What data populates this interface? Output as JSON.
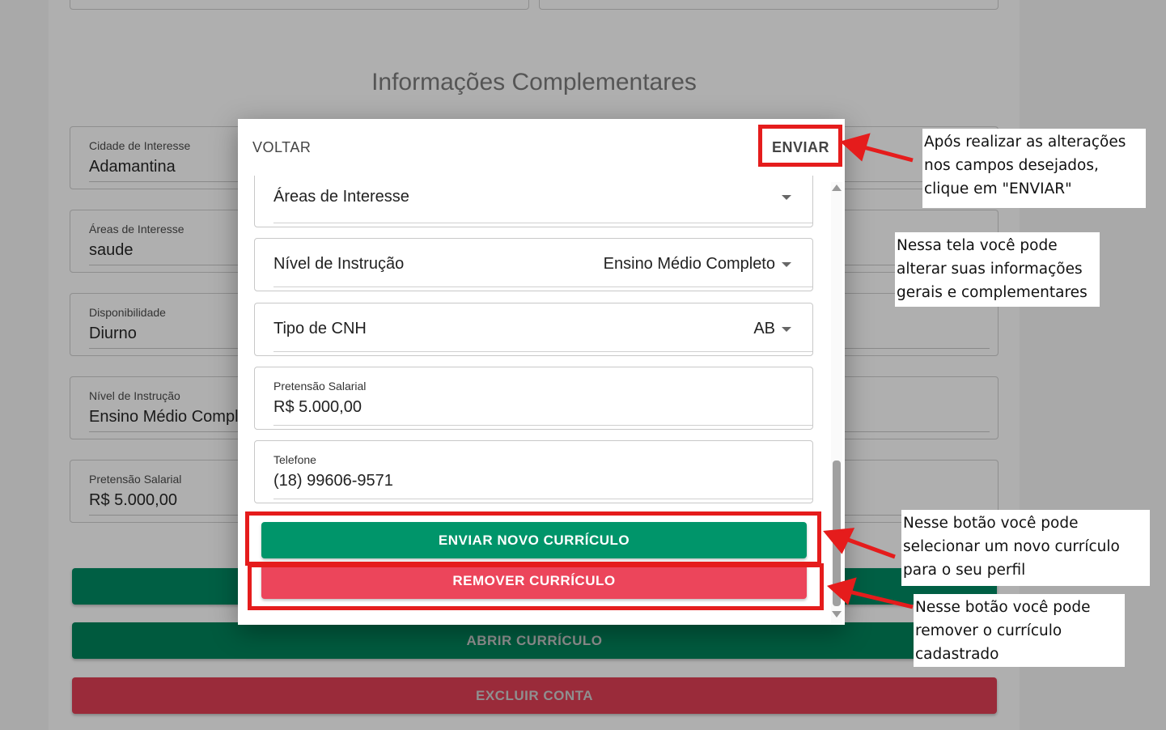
{
  "section_title": "Informações Complementares",
  "background_fields": [
    {
      "label": "Cidade de Interesse",
      "value": "Adamantina"
    },
    {
      "label": "Áreas de Interesse",
      "value": "saude"
    },
    {
      "label": "Disponibilidade",
      "value": "Diurno"
    },
    {
      "label": "Nível de Instrução",
      "value": "Ensino Médio Completo"
    },
    {
      "label": "Pretensão Salarial",
      "value": "R$ 5.000,00"
    }
  ],
  "background_buttons": {
    "open_resume": "ABRIR CURRÍCULO",
    "delete_account": "EXCLUIR CONTA"
  },
  "modal": {
    "back": "VOLTAR",
    "send": "ENVIAR",
    "areas_label": "Áreas de Interesse",
    "education_label": "Nível de Instrução",
    "education_value": "Ensino Médio Completo",
    "cnh_label": "Tipo de CNH",
    "cnh_value": "AB",
    "salary_label": "Pretensão Salarial",
    "salary_value": "R$ 5.000,00",
    "phone_label": "Telefone",
    "phone_value": "(18) 99606-9571",
    "upload_resume": "ENVIAR NOVO CURRÍCULO",
    "remove_resume": "REMOVER CURRÍCULO"
  },
  "annotations": {
    "send_note": "Após realizar as alterações nos campos desejados, clique em \"ENVIAR\"",
    "screen_note": "Nessa tela você pode alterar suas informações gerais e complementares",
    "upload_note": "Nesse botão você pode selecionar um novo currículo para o seu perfil",
    "remove_note": "Nesse botão você pode remover o currículo cadastrado"
  },
  "colors": {
    "green": "#00956a",
    "red": "#ec455b",
    "annotation_red": "#e51c1c"
  }
}
